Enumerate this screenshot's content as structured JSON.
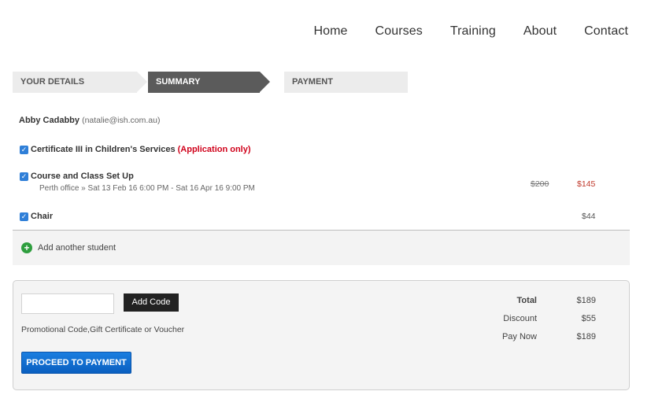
{
  "nav": {
    "items": [
      "Home",
      "Courses",
      "Training",
      "About",
      "Contact"
    ]
  },
  "steps": {
    "step1": "YOUR DETAILS",
    "step2": "SUMMARY",
    "step3": "PAYMENT",
    "active": "SUMMARY"
  },
  "student": {
    "name": "Abby Cadabby",
    "email": "(natalie@ish.com.au)"
  },
  "items": [
    {
      "title": "Certificate III in Children's Services",
      "note": "(Application only)",
      "checked": true
    },
    {
      "title": "Course and Class Set Up",
      "subtitle": "Perth office » Sat 13 Feb 16 6:00 PM - Sat 16 Apr 16 9:00 PM",
      "price_old": "$200",
      "price_new": "$145",
      "checked": true
    },
    {
      "title": "Chair",
      "price": "$44",
      "checked": true
    }
  ],
  "add_student": {
    "label": "Add another student"
  },
  "promo": {
    "input_value": "",
    "button_label": "Add Code",
    "note": "Promotional Code,Gift Certificate or Voucher",
    "proceed_label": "PROCEED TO PAYMENT"
  },
  "totals": {
    "total_label": "Total",
    "total_value": "$189",
    "discount_label": "Discount",
    "discount_value": "$55",
    "pay_now_label": "Pay Now",
    "pay_now_value": "$189"
  },
  "colors": {
    "accent_blue": "#1a7ee0",
    "active_step": "#5b5b5b",
    "alert_red": "#d0021b",
    "add_green": "#2e9e3e"
  }
}
